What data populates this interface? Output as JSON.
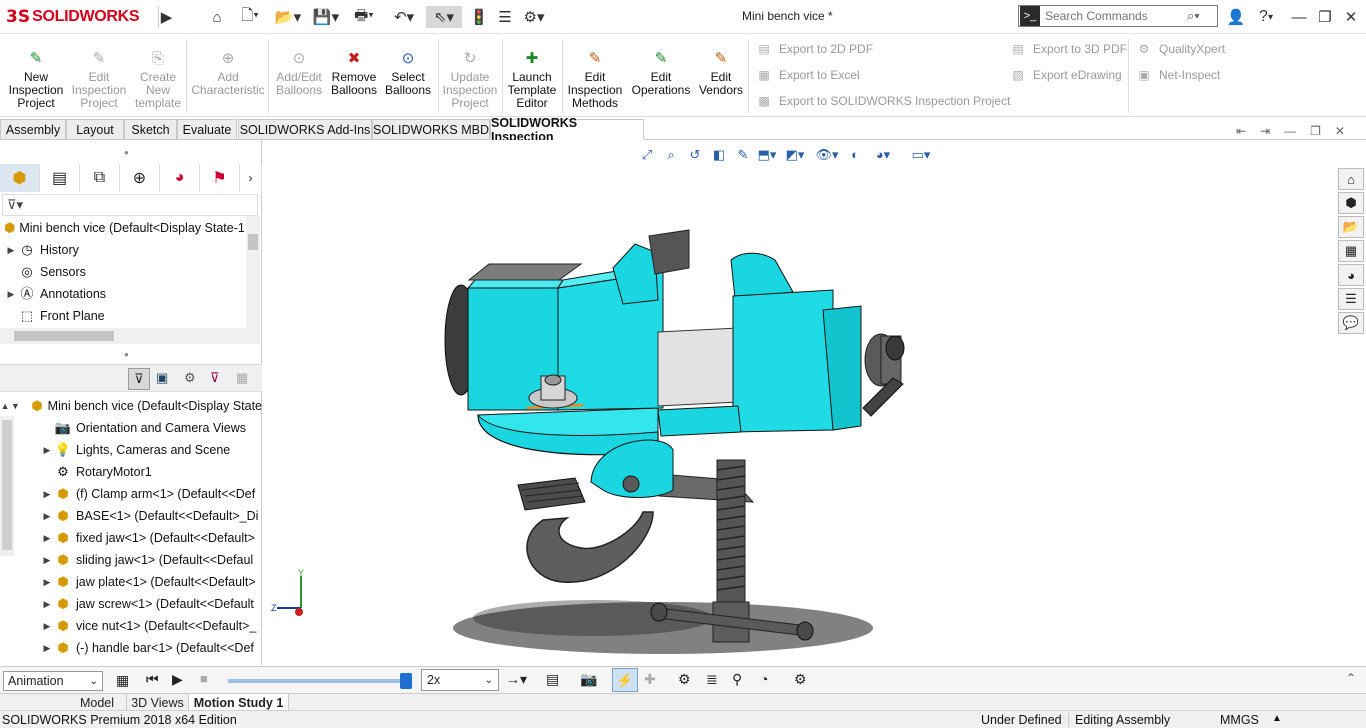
{
  "app": {
    "logo_mark": "3S",
    "logo_text": "SOLIDWORKS",
    "document_title": "Mini bench vice *",
    "search_placeholder": "Search Commands",
    "help_label": "?"
  },
  "command_manager": {
    "buttons": [
      {
        "label": "New\nInspection\nProject",
        "enabled": true,
        "icon": "new-inspection-icon"
      },
      {
        "label": "Edit\nInspection\nProject",
        "enabled": false,
        "icon": "edit-inspection-icon"
      },
      {
        "label": "Create\nNew\ntemplate",
        "enabled": false,
        "icon": "create-template-icon"
      },
      {
        "label": "Add\nCharacteristic",
        "enabled": false,
        "icon": "add-characteristic-icon"
      },
      {
        "label": "Add/Edit\nBalloons",
        "enabled": false,
        "icon": "add-balloons-icon"
      },
      {
        "label": "Remove\nBalloons",
        "enabled": true,
        "icon": "remove-balloons-icon"
      },
      {
        "label": "Select\nBalloons",
        "enabled": true,
        "icon": "select-balloons-icon"
      },
      {
        "label": "Update\nInspection\nProject",
        "enabled": false,
        "icon": "update-inspection-icon"
      },
      {
        "label": "Launch\nTemplate\nEditor",
        "enabled": true,
        "icon": "launch-template-icon"
      },
      {
        "label": "Edit\nInspection\nMethods",
        "enabled": true,
        "icon": "edit-methods-icon"
      },
      {
        "label": "Edit\nOperations",
        "enabled": true,
        "icon": "edit-operations-icon"
      },
      {
        "label": "Edit\nVendors",
        "enabled": true,
        "icon": "edit-vendors-icon"
      }
    ],
    "export_2d_pdf": "Export to 2D PDF",
    "export_excel": "Export to Excel",
    "export_inspection_project": "Export to SOLIDWORKS Inspection Project",
    "export_3d_pdf": "Export to 3D PDF",
    "export_edrawing": "Export eDrawing",
    "quality_xpert": "QualityXpert",
    "net_inspect": "Net-Inspect"
  },
  "tabs": [
    "Assembly",
    "Layout",
    "Sketch",
    "Evaluate",
    "SOLIDWORKS Add-Ins",
    "SOLIDWORKS MBD",
    "SOLIDWORKS Inspection"
  ],
  "active_tab": "SOLIDWORKS Inspection",
  "feature_tree_top": {
    "root": "Mini bench vice  (Default<Display State-1>",
    "items": [
      "History",
      "Sensors",
      "Annotations",
      "Front Plane"
    ]
  },
  "feature_tree_bottom": {
    "root": "Mini bench vice  (Default<Display State",
    "items": [
      {
        "label": "Orientation and Camera Views",
        "expandable": false,
        "icon": "camera-icon"
      },
      {
        "label": "Lights, Cameras and Scene",
        "expandable": true,
        "icon": "lights-icon"
      },
      {
        "label": "RotaryMotor1",
        "expandable": false,
        "icon": "motor-icon"
      },
      {
        "label": "(f) Clamp arm<1> (Default<<Def",
        "expandable": true,
        "icon": "part-icon"
      },
      {
        "label": "BASE<1> (Default<<Default>_Di",
        "expandable": true,
        "icon": "part-icon"
      },
      {
        "label": "fixed jaw<1> (Default<<Default>",
        "expandable": true,
        "icon": "part-icon"
      },
      {
        "label": "sliding jaw<1> (Default<<Defaul",
        "expandable": true,
        "icon": "part-icon"
      },
      {
        "label": "jaw plate<1> (Default<<Default>",
        "expandable": true,
        "icon": "part-icon"
      },
      {
        "label": "jaw screw<1> (Default<<Default",
        "expandable": true,
        "icon": "part-icon"
      },
      {
        "label": "vice nut<1> (Default<<Default>_",
        "expandable": true,
        "icon": "part-icon"
      },
      {
        "label": "(-) handle bar<1> (Default<<Def",
        "expandable": true,
        "icon": "part-icon"
      }
    ]
  },
  "motion": {
    "study_type": "Animation",
    "playback_speed": "2x",
    "slider_fraction": 0.97
  },
  "bottom_tabs": [
    "Model",
    "3D Views",
    "Motion Study 1"
  ],
  "active_bottom_tab": "Motion Study 1",
  "status": {
    "edition": "SOLIDWORKS Premium 2018 x64 Edition",
    "definition": "Under Defined",
    "mode": "Editing Assembly",
    "units": "MMGS"
  },
  "colors": {
    "model_cyan": "#19e0ea",
    "brand_red": "#d6001c",
    "active_tab_bg": "#ffffff",
    "disabled_text": "#9a9a9a"
  }
}
